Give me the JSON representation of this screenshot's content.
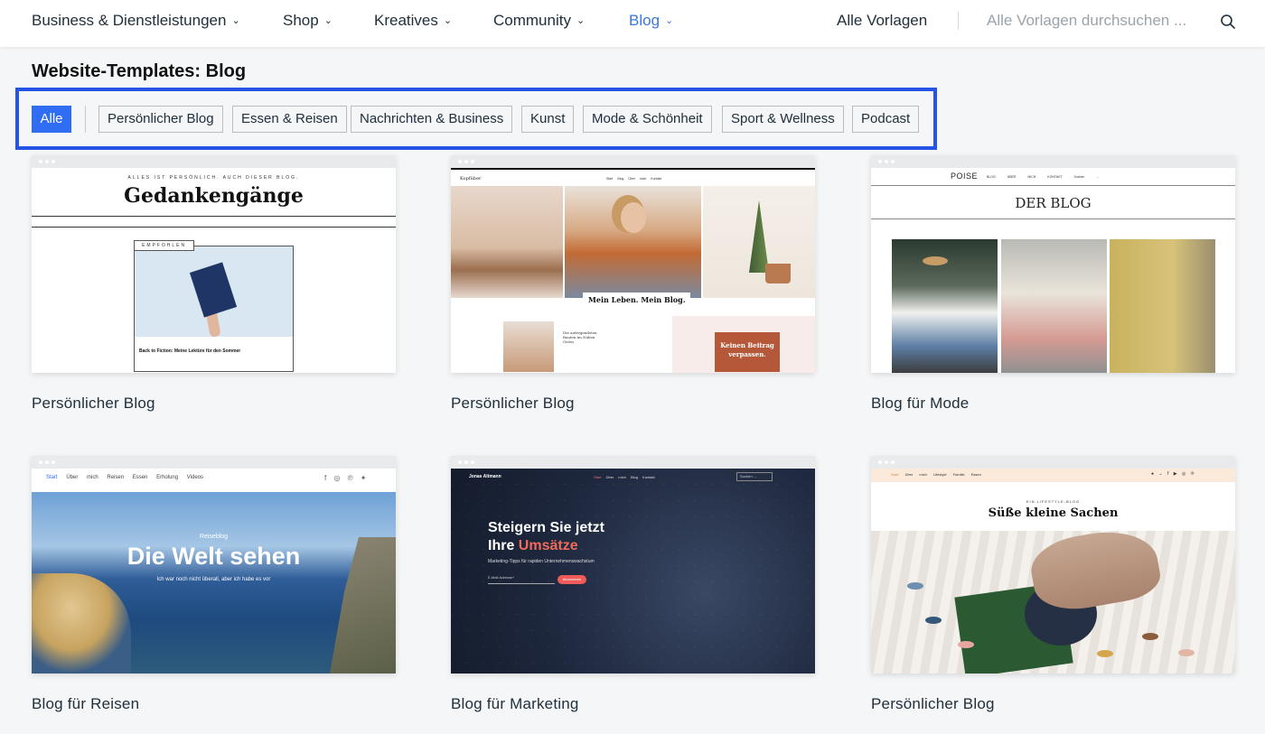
{
  "nav": {
    "items": [
      {
        "label": "Business & Dienstleistungen",
        "chevron": "chevron-down-icon",
        "active": false
      },
      {
        "label": "Shop",
        "chevron": "chevron-down-icon",
        "active": false
      },
      {
        "label": "Kreatives",
        "chevron": "chevron-down-icon",
        "active": false
      },
      {
        "label": "Community",
        "chevron": "chevron-down-icon",
        "active": false
      },
      {
        "label": "Blog",
        "chevron": "chevron-down-icon",
        "active": true
      }
    ],
    "all_templates": "Alle Vorlagen",
    "search_placeholder": "Alle Vorlagen durchsuchen ...",
    "search_icon": "search-icon",
    "active_color": "#3c78d8"
  },
  "page_title": "Website-Templates: Blog",
  "filters": {
    "highlight_color": "#2453e5",
    "chips": [
      {
        "label": "Alle",
        "active": true
      },
      {
        "label": "Persönlicher Blog",
        "active": false
      },
      {
        "label": "Essen & Reisen",
        "active": false
      },
      {
        "label": "Nachrichten & Business",
        "active": false
      },
      {
        "label": "Kunst",
        "active": false
      },
      {
        "label": "Mode & Schönheit",
        "active": false
      },
      {
        "label": "Sport & Wellness",
        "active": false
      },
      {
        "label": "Podcast",
        "active": false
      }
    ]
  },
  "templates": [
    {
      "label": "Persönlicher Blog",
      "preview": {
        "tagline": "ALLES IST PERSÖNLICH. AUCH DIESER BLOG.",
        "title": "Gedankengänge",
        "badge": "EMPFOHLEN",
        "post_title": "Back to Fiction: Meine Lektüre für den Sommer"
      }
    },
    {
      "label": "Persönlicher Blog",
      "preview": {
        "logo": "Kopfüber",
        "menu": "Start Blog Über mich Kontakt",
        "caption": "Mein Leben. Mein Blog.",
        "post_title": "Die aufregendsten Bauten im Nahen Osten",
        "cta": "Keinen Beitrag verpassen."
      }
    },
    {
      "label": "Blog für Mode",
      "preview": {
        "logo": "POISE",
        "menu": "BLOG ÜBER MICH KONTAKT Suchen ...",
        "title": "DER BLOG"
      }
    },
    {
      "label": "Blog für Reisen",
      "preview": {
        "menu": [
          "Start",
          "Über mich",
          "Reisen",
          "Essen",
          "Erholung",
          "Videos"
        ],
        "kicker": "Reiseblog",
        "title": "Die Welt sehen",
        "subtitle": "Ich war noch nicht überall, aber ich habe es vor"
      }
    },
    {
      "label": "Blog für Marketing",
      "preview": {
        "logo": "Jonas Altmann",
        "menu": [
          "Start",
          "Über mich",
          "Blog",
          "Kontakt"
        ],
        "search": "Suchen ...",
        "title_line1": "Steigern Sie jetzt",
        "title_line2_a": "Ihre ",
        "title_line2_b": "Umsätze",
        "subtitle": "Marketing-Tipps für rapiden Unternehmenswachstum",
        "input": "E-Mail-Adresse*",
        "button": "Abonnieren"
      }
    },
    {
      "label": "Persönlicher Blog",
      "preview": {
        "menu": [
          "Start",
          "Über mich",
          "Lifestyle",
          "Familie",
          "Essen"
        ],
        "kicker": "EIN LIFESTYLE-BLOG",
        "title": "Süße kleine Sachen"
      }
    }
  ]
}
